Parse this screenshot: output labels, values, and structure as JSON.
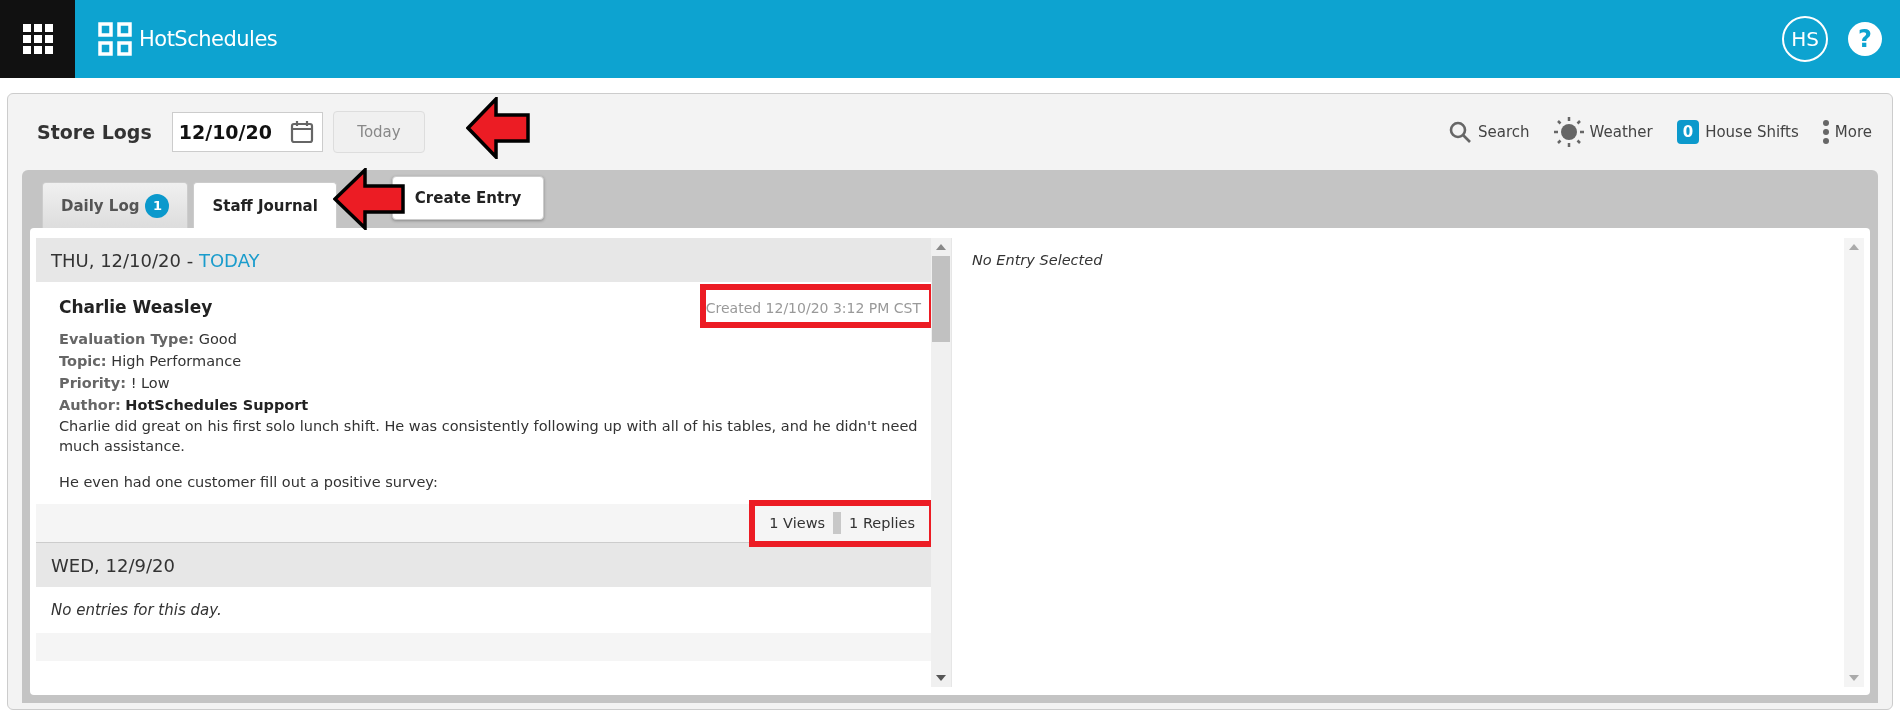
{
  "top_bar": {
    "brand": "HotSchedules",
    "avatar": "HS",
    "help": "?"
  },
  "page": {
    "title": "Store Logs",
    "date": "12/10/20",
    "today_button": "Today"
  },
  "toolbar": [
    {
      "kind": "search",
      "label": "Search"
    },
    {
      "kind": "weather",
      "label": "Weather"
    },
    {
      "kind": "count",
      "badge": "0",
      "label": "House Shifts"
    },
    {
      "kind": "more",
      "label": "More"
    }
  ],
  "tabs": [
    {
      "label": "Daily Log",
      "badge": "1",
      "selected": false
    },
    {
      "label": "Staff Journal",
      "selected": true
    }
  ],
  "create_button": "Create Entry",
  "days": [
    {
      "date": "THU, 12/10/20",
      "separator": " - ",
      "today": "TODAY",
      "entries": [
        {
          "name": "Charlie Weasley",
          "created": "Created 12/10/20 3:12 PM CST",
          "fields": [
            {
              "label": "Evaluation Type:",
              "value": "Good",
              "strong": false
            },
            {
              "label": "Topic:",
              "value": "High Performance",
              "strong": false
            },
            {
              "label": "Priority:",
              "value": "! Low",
              "strong": false
            },
            {
              "label": "Author:",
              "value": "HotSchedules Support",
              "strong": true
            }
          ],
          "paragraphs": [
            "Charlie did great on his first solo lunch shift. He was consistently following up with all of his tables, and he didn't need much assistance.",
            "He even had one customer fill out a positive survey:"
          ],
          "views": "1 Views",
          "replies": "1 Replies"
        }
      ]
    },
    {
      "date": "WED, 12/9/20",
      "empty": "No entries for this day."
    }
  ],
  "detail": {
    "empty": "No Entry Selected"
  }
}
